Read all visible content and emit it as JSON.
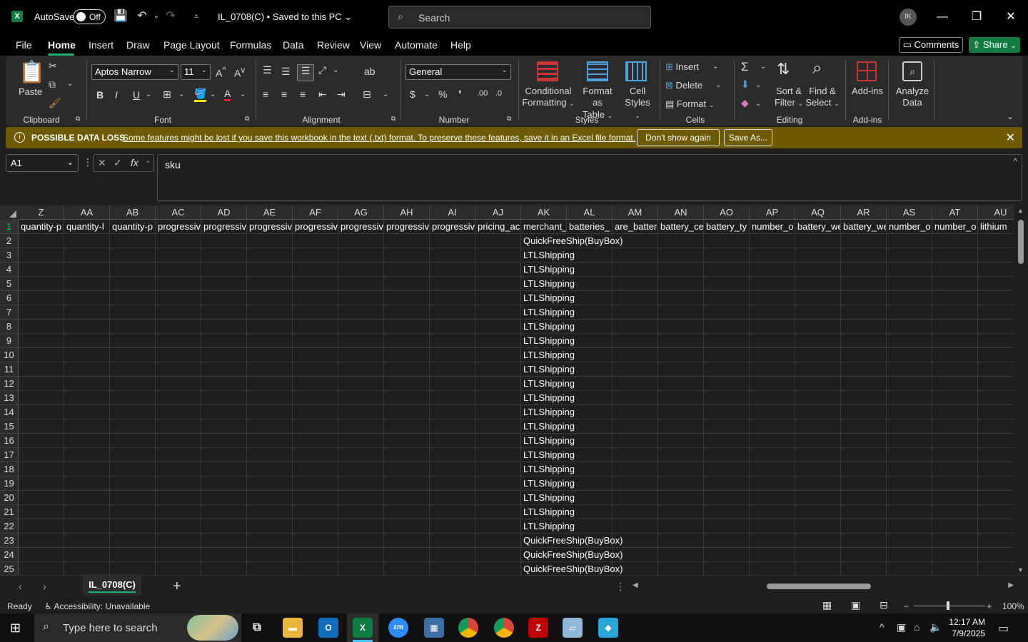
{
  "titlebar": {
    "app_logo": "X",
    "autosave_label": "AutoSave",
    "autosave_state": "Off",
    "doc_title": "IL_0708(C) • Saved to this PC",
    "search_placeholder": "Search",
    "avatar_initials": "IK"
  },
  "menu": {
    "tabs": [
      "File",
      "Home",
      "Insert",
      "Draw",
      "Page Layout",
      "Formulas",
      "Data",
      "Review",
      "View",
      "Automate",
      "Help"
    ],
    "comments_label": "Comments",
    "share_label": "Share"
  },
  "ribbon": {
    "clipboard": {
      "paste_label": "Paste",
      "group_label": "Clipboard"
    },
    "font": {
      "font_name": "Aptos Narrow",
      "font_size": "11",
      "group_label": "Font",
      "bold": "B",
      "italic": "I",
      "underline": "U"
    },
    "alignment": {
      "group_label": "Alignment"
    },
    "number": {
      "format": "General",
      "group_label": "Number",
      "currency": "$",
      "percent": "%",
      "comma": "❜"
    },
    "styles": {
      "conditional_1": "Conditional",
      "conditional_2": "Formatting",
      "format_table_1": "Format as",
      "format_table_2": "Table",
      "cell_styles_1": "Cell",
      "cell_styles_2": "Styles",
      "group_label": "Styles"
    },
    "cells": {
      "insert": "Insert",
      "delete": "Delete",
      "format": "Format",
      "group_label": "Cells"
    },
    "editing": {
      "sort_1": "Sort &",
      "sort_2": "Filter",
      "find_1": "Find &",
      "find_2": "Select",
      "group_label": "Editing"
    },
    "addins": {
      "addins_label": "Add-ins",
      "group_label": "Add-ins",
      "analyze_1": "Analyze",
      "analyze_2": "Data"
    }
  },
  "warning": {
    "title": "POSSIBLE DATA LOSS",
    "message": "Some features might be lost if you save this workbook in the text (.txt) format. To preserve these features, save it in an Excel file format.",
    "dont_show": "Don't show again",
    "save_as": "Save As..."
  },
  "formula_bar": {
    "name_box": "A1",
    "fx": "fx",
    "content": "sku"
  },
  "grid": {
    "columns": [
      "Z",
      "AA",
      "AB",
      "AC",
      "AD",
      "AE",
      "AF",
      "AG",
      "AH",
      "AI",
      "AJ",
      "AK",
      "AL",
      "AM",
      "AN",
      "AO",
      "AP",
      "AQ",
      "AR",
      "AS",
      "AT",
      "AU"
    ],
    "header_row": [
      "quantity-p",
      "quantity-l",
      "quantity-p",
      "progressiv",
      "progressiv",
      "progressiv",
      "progressiv",
      "progressiv",
      "progressiv",
      "progressiv",
      "pricing_ac",
      "merchant_",
      "batteries_",
      "are_batter",
      "battery_ce",
      "battery_ty",
      "number_o",
      "battery_we",
      "battery_we",
      "number_o",
      "number_o",
      "lithium"
    ],
    "rows": [
      "1",
      "2",
      "3",
      "4",
      "5",
      "6",
      "7",
      "8",
      "9",
      "10",
      "11",
      "12",
      "13",
      "14",
      "15",
      "16",
      "17",
      "18",
      "19",
      "20",
      "21",
      "22",
      "23",
      "24",
      "25"
    ],
    "ak_values": [
      "QuickFreeShip(BuyBox)",
      "LTLShipping",
      "LTLShipping",
      "LTLShipping",
      "LTLShipping",
      "LTLShipping",
      "LTLShipping",
      "LTLShipping",
      "LTLShipping",
      "LTLShipping",
      "LTLShipping",
      "LTLShipping",
      "LTLShipping",
      "LTLShipping",
      "LTLShipping",
      "LTLShipping",
      "LTLShipping",
      "LTLShipping",
      "LTLShipping",
      "LTLShipping",
      "LTLShipping",
      "QuickFreeShip(BuyBox)",
      "QuickFreeShip(BuyBox)",
      "QuickFreeShip(BuyBox)"
    ]
  },
  "sheets": {
    "active": "IL_0708(C)",
    "add": "+"
  },
  "status": {
    "ready": "Ready",
    "accessibility": "Accessibility: Unavailable",
    "zoom": "100%"
  },
  "taskbar": {
    "search_placeholder": "Type here to search",
    "time": "12:17 AM",
    "date": "7/9/2025"
  },
  "colors": {
    "accent_green": "#1ab26b",
    "excel_green": "#107c41",
    "warning_bg": "#6e5a00"
  }
}
